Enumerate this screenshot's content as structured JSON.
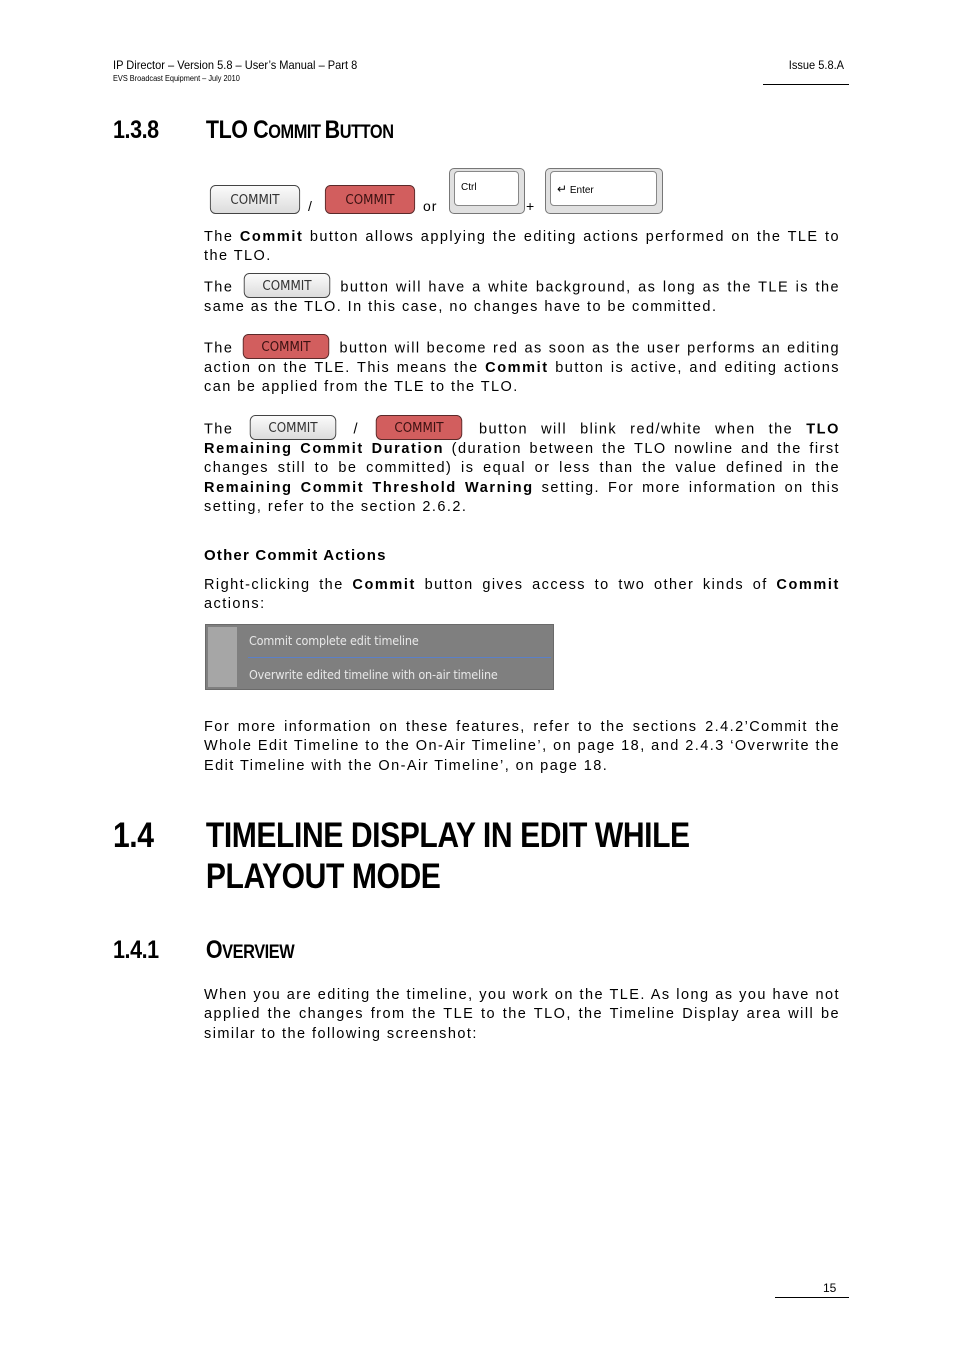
{
  "header": {
    "title": "IP Director – Version 5.8 – User’s Manual – Part 8",
    "subtitle": "EVS Broadcast Equipment – July 2010",
    "issue": "Issue 5.8.A"
  },
  "section_138": {
    "number": "1.3.8",
    "title_cap1": "TLO C",
    "title_small1": "OMMIT ",
    "title_cap2": "B",
    "title_small2": "UTTON"
  },
  "shortcut_row": {
    "commit_white_label": "COMMIT",
    "commit_red_label": "COMMIT",
    "slash": "/",
    "or": "or",
    "ctrl_key": "Ctrl",
    "plus": "+",
    "enter_key": "Enter",
    "enter_symbol": "↵"
  },
  "paragraphs": {
    "p1_a": "The ",
    "p1_b": "Commit",
    "p1_c": " button allows applying the editing actions performed on the TLE to the TLO.",
    "p2_a": "The ",
    "p2_btn": "COMMIT",
    "p2_c": " button will have a white background, as long as the TLE is the same as the TLO. In this case, no changes have to be committed.",
    "p3_a": "The ",
    "p3_btn": "COMMIT",
    "p3_c": " button will become red as soon as the user performs an editing action on the TLE. This means the ",
    "p3_d": "Commit",
    "p3_e": " button is active, and editing actions can be applied from the TLE to the TLO.",
    "p4_a": "The ",
    "p4_btn1": "COMMIT",
    "p4_slash": " / ",
    "p4_btn2": "COMMIT",
    "p4_c": " button will blink red/white when the ",
    "p4_d": "TLO Remaining Commit Duration",
    "p4_e": " (duration between the TLO nowline and the first changes still to be committed) is equal or less than the value defined in the ",
    "p4_f": "Remaining Commit Threshold Warning",
    "p4_g": " setting. For more information on this setting, refer to the section 2.6.2."
  },
  "other_actions": {
    "heading": "Other Commit Actions",
    "text_a": "Right-clicking the ",
    "text_b": "Commit",
    "text_c": " button gives access to two other kinds of ",
    "text_d": "Commit",
    "text_e": " actions:",
    "menu_items": [
      "Commit complete edit timeline",
      "Overwrite edited timeline with on-air timeline"
    ],
    "more_info": "For more information on these features, refer to the sections 2.4.2’Commit the Whole Edit Timeline to the On-Air Timeline’, on page 18, and 2.4.3 ‘Overwrite the Edit Timeline with the On-Air Timeline’, on page 18."
  },
  "section_14": {
    "number": "1.4",
    "title_line1": "TIMELINE DISPLAY IN EDIT WHILE",
    "title_line2": "PLAYOUT MODE"
  },
  "section_141": {
    "number": "1.4.1",
    "title_cap": "O",
    "title_small": "VERVIEW",
    "text": "When you are editing the timeline, you work on the TLE. As long as you have not applied the changes from the TLE to the TLO, the Timeline Display area will be similar to the following screenshot:"
  },
  "footer": {
    "page_number": "15"
  },
  "colors": {
    "commit_red": "#d25e5e",
    "menu_bg": "#7f7f7f",
    "menu_separator": "#5b80c8"
  }
}
